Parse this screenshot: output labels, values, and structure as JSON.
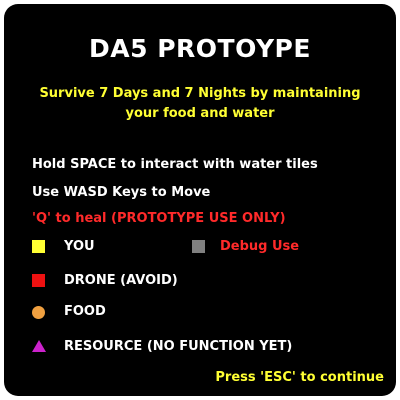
{
  "title": "DA5 PROTOYPE",
  "subtitle": "Survive 7 Days and 7 Nights by maintaining your food and water",
  "instructions": {
    "water": "Hold SPACE to interact with water tiles",
    "move": "Use WASD Keys to Move",
    "heal": "'Q' to heal (PROTOTYPE USE ONLY)"
  },
  "legend": {
    "you": {
      "label": "YOU",
      "icon": "yellow-square-icon",
      "color": "#ffff33"
    },
    "debug": {
      "label": "Debug Use",
      "icon": "gray-square-icon",
      "color": "#808080"
    },
    "drone": {
      "label": "DRONE (AVOID)",
      "icon": "red-square-icon",
      "color": "#ee1111"
    },
    "food": {
      "label": "FOOD",
      "icon": "orange-circle-icon",
      "color": "#f0a040"
    },
    "resource": {
      "label": "RESOURCE (NO FUNCTION YET)",
      "icon": "magenta-triangle-icon",
      "color": "#cc22cc"
    }
  },
  "continue_prompt": "Press 'ESC' to continue",
  "colors": {
    "background": "#000000",
    "highlight": "#ffff33",
    "warning": "#ff2a2a"
  }
}
